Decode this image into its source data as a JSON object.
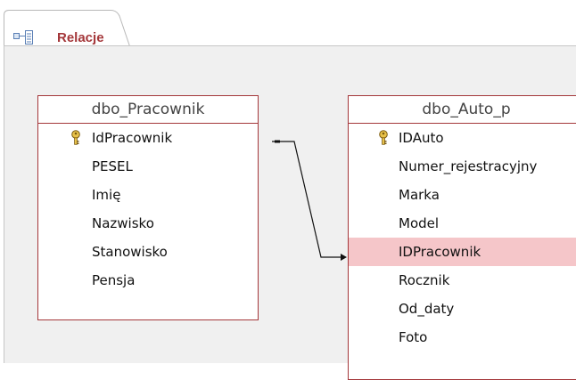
{
  "tab": {
    "icon": "relationships-icon",
    "label": "Relacje"
  },
  "tables": {
    "pracownik": {
      "title": "dbo_Pracownik",
      "fields": [
        {
          "name": "IdPracownik",
          "primary_key": true
        },
        {
          "name": "PESEL",
          "primary_key": false
        },
        {
          "name": "Imię",
          "primary_key": false
        },
        {
          "name": "Nazwisko",
          "primary_key": false
        },
        {
          "name": "Stanowisko",
          "primary_key": false
        },
        {
          "name": "Pensja",
          "primary_key": false
        }
      ]
    },
    "auto": {
      "title": "dbo_Auto_p",
      "fields": [
        {
          "name": "IDAuto",
          "primary_key": true
        },
        {
          "name": "Numer_rejestracyjny",
          "primary_key": false
        },
        {
          "name": "Marka",
          "primary_key": false
        },
        {
          "name": "Model",
          "primary_key": false
        },
        {
          "name": "IDPracownik",
          "primary_key": false,
          "selected": true
        },
        {
          "name": "Rocznik",
          "primary_key": false
        },
        {
          "name": "Od_daty",
          "primary_key": false
        },
        {
          "name": "Foto",
          "primary_key": false
        }
      ]
    }
  },
  "relationship": {
    "from": "dbo_Pracownik.IdPracownik",
    "to": "dbo_Auto_p.IDPracownik"
  },
  "colors": {
    "accent": "#a4373a",
    "selection": "#f5c6c9",
    "canvas": "#f0f0f0"
  }
}
